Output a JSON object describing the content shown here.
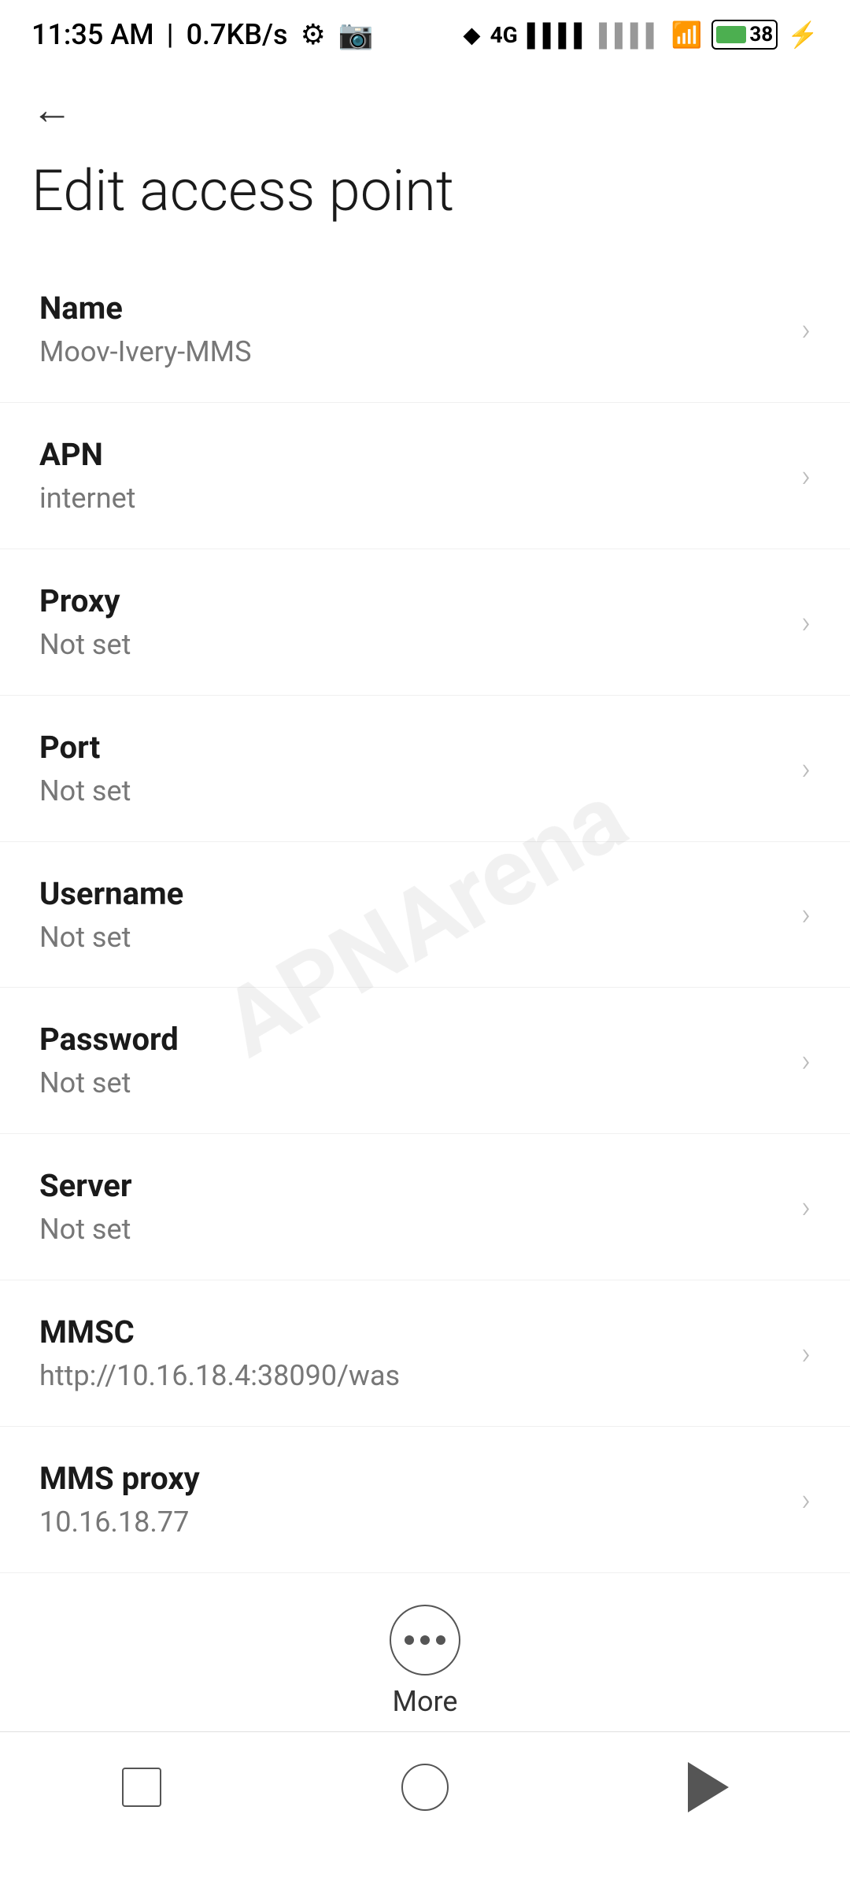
{
  "statusBar": {
    "time": "11:35 AM",
    "speed": "0.7KB/s"
  },
  "header": {
    "backLabel": "←",
    "title": "Edit access point"
  },
  "settingsItems": [
    {
      "label": "Name",
      "value": "Moov-Ivery-MMS"
    },
    {
      "label": "APN",
      "value": "internet"
    },
    {
      "label": "Proxy",
      "value": "Not set"
    },
    {
      "label": "Port",
      "value": "Not set"
    },
    {
      "label": "Username",
      "value": "Not set"
    },
    {
      "label": "Password",
      "value": "Not set"
    },
    {
      "label": "Server",
      "value": "Not set"
    },
    {
      "label": "MMSC",
      "value": "http://10.16.18.4:38090/was"
    },
    {
      "label": "MMS proxy",
      "value": "10.16.18.77"
    }
  ],
  "moreButton": {
    "label": "More"
  },
  "watermark": {
    "text": "APNArena"
  }
}
